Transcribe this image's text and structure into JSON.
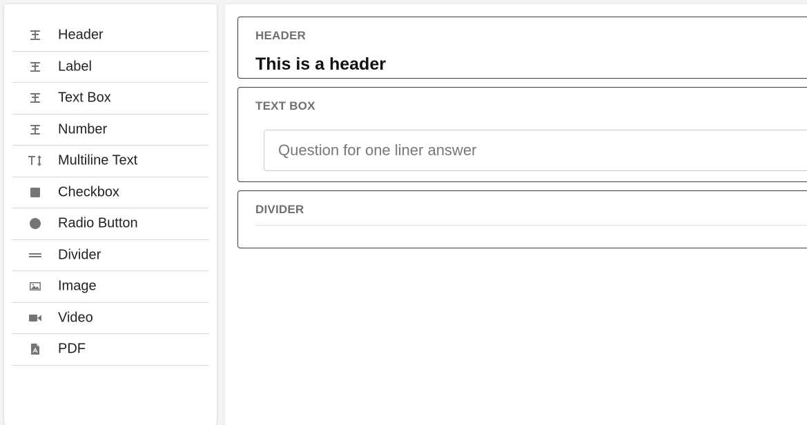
{
  "palette": {
    "items": [
      {
        "label": "Header",
        "icon": "text-fields-icon"
      },
      {
        "label": "Label",
        "icon": "text-fields-icon"
      },
      {
        "label": "Text Box",
        "icon": "text-fields-icon"
      },
      {
        "label": "Number",
        "icon": "text-fields-icon"
      },
      {
        "label": "Multiline Text",
        "icon": "text-height-icon"
      },
      {
        "label": "Checkbox",
        "icon": "square-icon"
      },
      {
        "label": "Radio Button",
        "icon": "circle-icon"
      },
      {
        "label": "Divider",
        "icon": "horizontal-rule-icon"
      },
      {
        "label": "Image",
        "icon": "image-icon"
      },
      {
        "label": "Video",
        "icon": "videocam-icon"
      },
      {
        "label": "PDF",
        "icon": "pdf-file-icon"
      }
    ]
  },
  "canvas": {
    "header_card": {
      "type_label": "HEADER",
      "text": "This is a header"
    },
    "textbox_card": {
      "type_label": "TEXT BOX",
      "placeholder": "Question for one liner answer"
    },
    "divider_card": {
      "type_label": "DIVIDER"
    }
  },
  "colors": {
    "icon": "#757575",
    "card_border": "#3a3a3a",
    "type_label": "#6f6f6f",
    "separator": "#d7d7d7"
  }
}
